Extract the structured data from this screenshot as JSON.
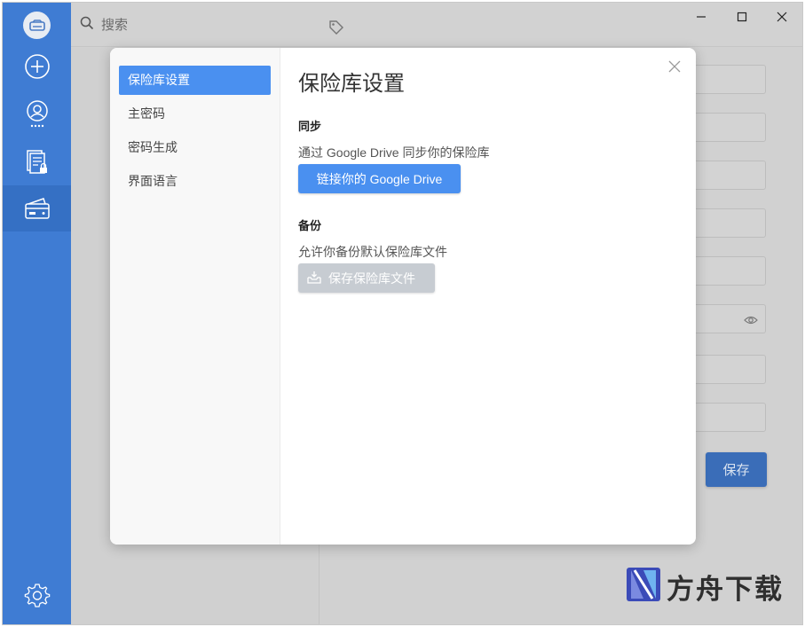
{
  "search": {
    "placeholder": "搜索"
  },
  "icons": {
    "rail": [
      "vault-logo-icon",
      "add-icon",
      "account-icon",
      "document-lock-icon",
      "wallet-icon",
      "gear-icon"
    ],
    "topbar": [
      "search-icon",
      "tag-icon",
      "minimize-icon",
      "maximize-icon",
      "close-icon"
    ]
  },
  "background_form": {
    "save_label": "保存"
  },
  "dialog": {
    "nav": [
      {
        "label": "保险库设置"
      },
      {
        "label": "主密码"
      },
      {
        "label": "密码生成"
      },
      {
        "label": "界面语言"
      }
    ],
    "title": "保险库设置",
    "sync": {
      "heading": "同步",
      "description": "通过 Google Drive 同步你的保险库",
      "button_label": "链接你的 Google Drive"
    },
    "backup": {
      "heading": "备份",
      "description": "允许你备份默认保险库文件",
      "button_label": "保存保险库文件"
    }
  },
  "watermark": {
    "text": "方舟下载"
  },
  "colors": {
    "rail": "#3f7cd3",
    "rail_active": "#3570c4",
    "accent": "#4a90f0",
    "disabled_button": "#c7ccd2"
  }
}
